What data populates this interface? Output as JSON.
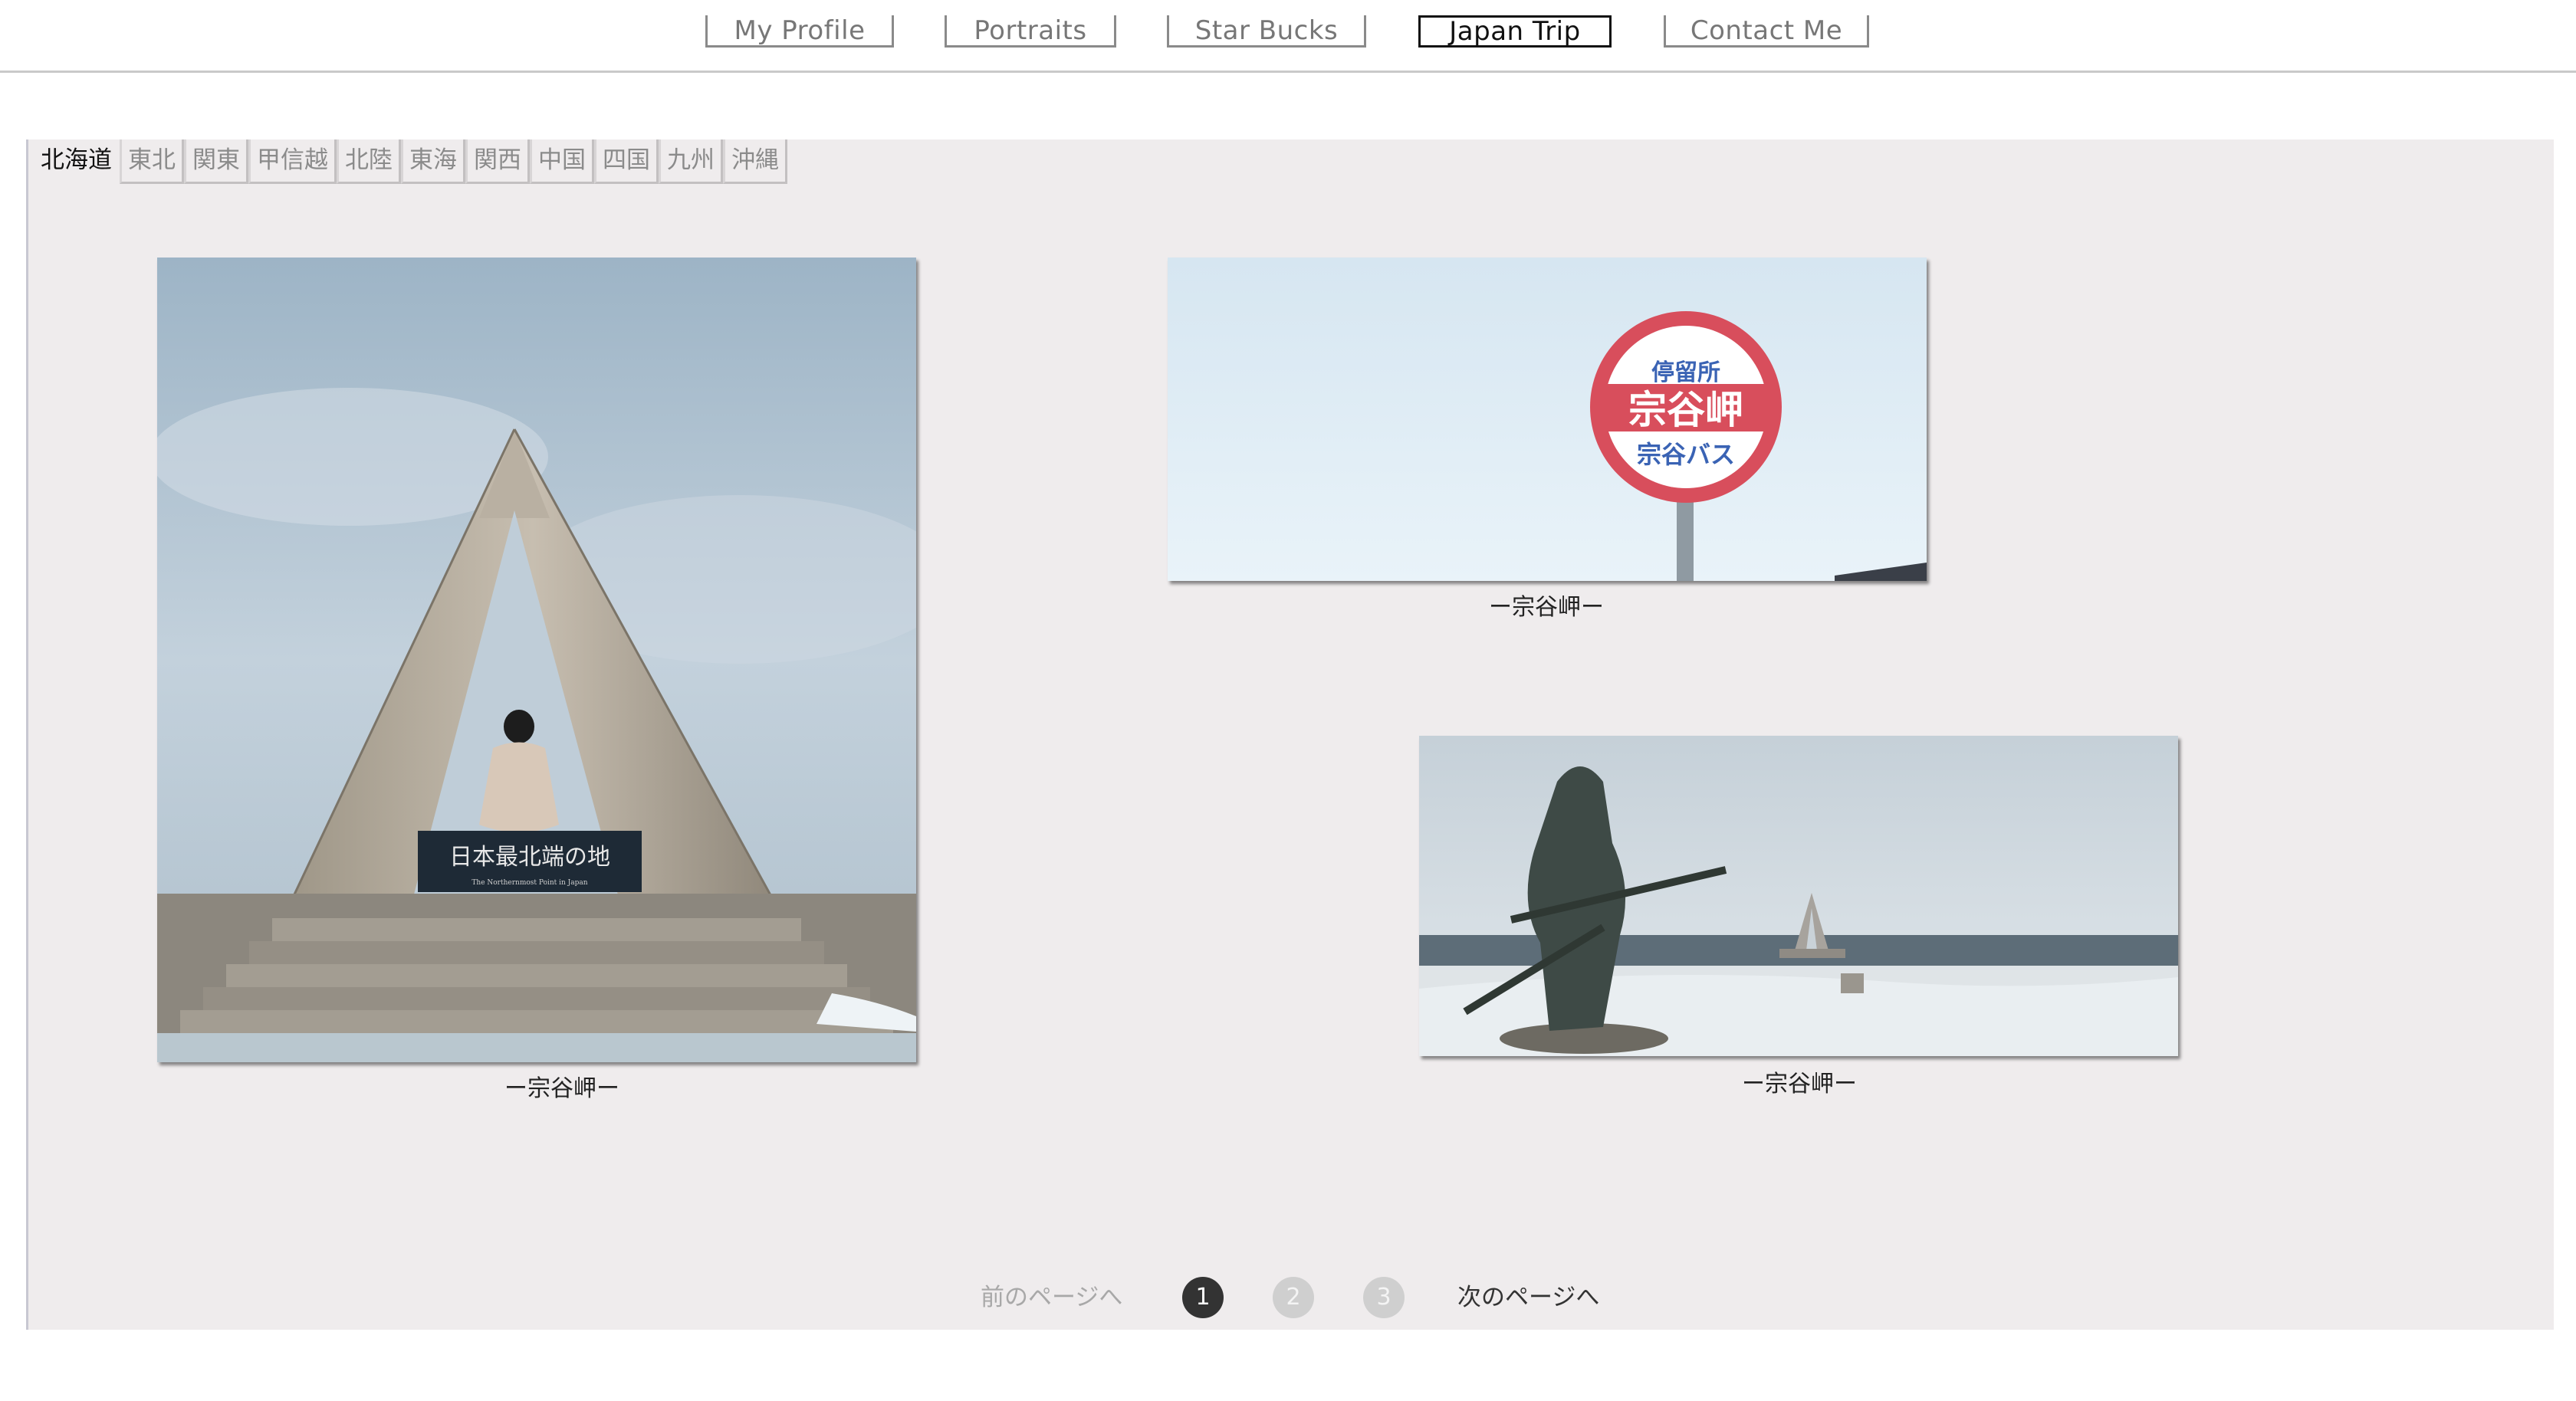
{
  "nav": {
    "items": [
      {
        "label": "My Profile"
      },
      {
        "label": "Portraits"
      },
      {
        "label": "Star Bucks"
      },
      {
        "label": "Japan Trip",
        "active": true
      },
      {
        "label": "Contact Me"
      }
    ]
  },
  "regions": {
    "tabs": [
      {
        "label": "北海道",
        "active": true
      },
      {
        "label": "東北"
      },
      {
        "label": "関東"
      },
      {
        "label": "甲信越"
      },
      {
        "label": "北陸"
      },
      {
        "label": "東海"
      },
      {
        "label": "関西"
      },
      {
        "label": "中国"
      },
      {
        "label": "四国"
      },
      {
        "label": "九州"
      },
      {
        "label": "沖縄"
      }
    ]
  },
  "photos": [
    {
      "caption": "ー宗谷岬ー",
      "plaque_text": "日本最北端の地",
      "plaque_subtext": "The Northernmost Point in Japan"
    },
    {
      "caption": "ー宗谷岬ー",
      "sign_top": "停留所",
      "sign_main": "宗谷岬",
      "sign_bottom": "宗谷バス"
    },
    {
      "caption": "ー宗谷岬ー"
    }
  ],
  "pagination": {
    "prev_label": "前のページへ",
    "next_label": "次のページへ",
    "pages": [
      "1",
      "2",
      "3"
    ],
    "current": "1"
  },
  "colors": {
    "panel_bg": "#efeced",
    "active_text": "#111111",
    "inactive_text": "#777777",
    "sign_red": "#e0505f"
  }
}
